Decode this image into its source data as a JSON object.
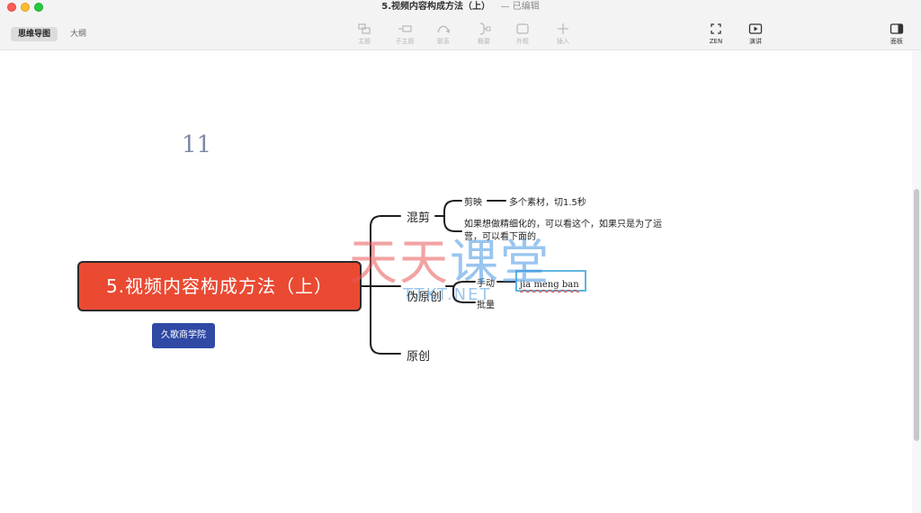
{
  "window": {
    "title": "5.视频内容构成方法（上）",
    "status": "— 已编辑"
  },
  "view_tabs": [
    {
      "label": "思维导图",
      "active": true
    },
    {
      "label": "大纲",
      "active": false
    }
  ],
  "toolbar": {
    "topic": "主题",
    "subtopic": "子主题",
    "relationship": "联系",
    "summary": "概要",
    "boundary": "外框",
    "insert": "插入",
    "zen": "ZEN",
    "present": "演讲",
    "panel": "面板"
  },
  "canvas": {
    "page_number": "11",
    "root_topic": "5.视频内容构成方法（上）",
    "floating_label": "久歌商学院",
    "branches": [
      {
        "label": "混剪",
        "children": [
          {
            "label": "剪映",
            "note": "多个素材，切1.5秒"
          },
          {
            "label": "如果想做精细化的，可以看这个，如果只是为了运营，可以看下面的"
          }
        ]
      },
      {
        "label": "伪原创",
        "children": [
          {
            "label": "手动",
            "editing_text": "jia meng ban"
          },
          {
            "label": "批量"
          }
        ]
      },
      {
        "label": "原创"
      }
    ]
  },
  "watermark": {
    "text_red": "天天",
    "text_blue": "课堂",
    "sub": "TTKT.NET"
  },
  "colors": {
    "root_fill": "#ea4a32",
    "floating_label_fill": "#2f49a5",
    "edit_border": "#5fb4e0",
    "connector": "#1e1e1e"
  }
}
